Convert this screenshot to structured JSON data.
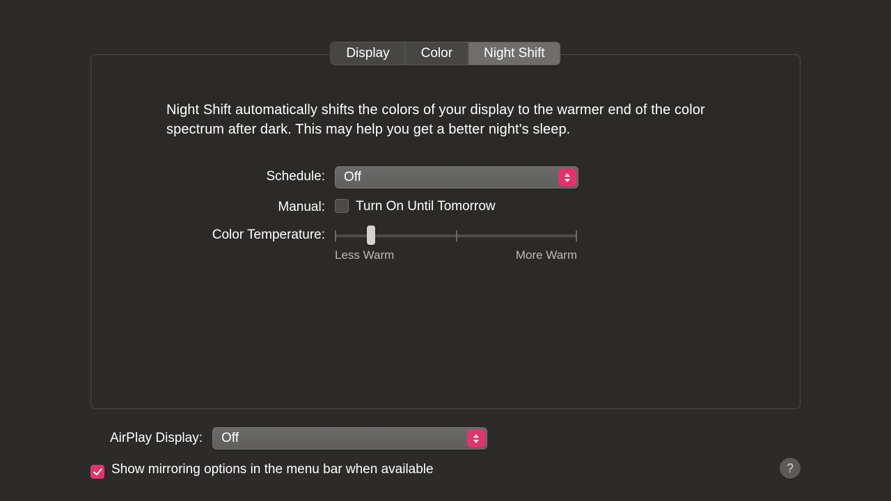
{
  "tabs": {
    "display": "Display",
    "color": "Color",
    "night_shift": "Night Shift",
    "active": "night_shift"
  },
  "night_shift": {
    "description": "Night Shift automatically shifts the colors of your display to the warmer end of the color spectrum after dark. This may help you get a better night's sleep.",
    "schedule_label": "Schedule:",
    "schedule_value": "Off",
    "manual_label": "Manual:",
    "manual_checkbox_label": "Turn On Until Tomorrow",
    "manual_checked": false,
    "temp_label": "Color Temperature:",
    "temp_value_percent": 15,
    "temp_tick_percent": 50,
    "temp_min_label": "Less Warm",
    "temp_max_label": "More Warm"
  },
  "airplay": {
    "label": "AirPlay Display:",
    "value": "Off"
  },
  "mirroring": {
    "checked": true,
    "label": "Show mirroring options in the menu bar when available"
  },
  "help_glyph": "?",
  "accent_color": "#e33270"
}
